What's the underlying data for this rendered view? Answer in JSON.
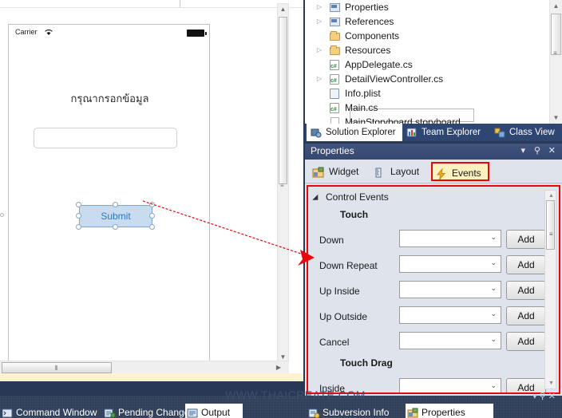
{
  "designer": {
    "device": {
      "status_bar": {
        "carrier": "Carrier",
        "wifi_icon": "wifi-icon",
        "battery_icon": "battery-icon"
      },
      "label_text": "กรุณากรอกข้อมูล",
      "text_field_value": "",
      "submit_button_label": "Submit"
    },
    "h_scroll_grip": "⦀",
    "h_scroll_right_arrow": "▶",
    "v_scroll_up_arrow": "▲",
    "v_scroll_down_arrow": "▼",
    "v_scroll_grip": "≡"
  },
  "solution_explorer": {
    "tree": [
      {
        "label": "Properties",
        "icon": "properties-icon",
        "expander": "▷",
        "indent": 30
      },
      {
        "label": "References",
        "icon": "references-icon",
        "expander": "▷",
        "indent": 30
      },
      {
        "label": "Components",
        "icon": "folder-icon",
        "expander": "",
        "indent": 30
      },
      {
        "label": "Resources",
        "icon": "folder-icon",
        "expander": "▷",
        "indent": 30
      },
      {
        "label": "AppDelegate.cs",
        "icon": "csharp-file-icon",
        "expander": "",
        "indent": 30
      },
      {
        "label": "DetailViewController.cs",
        "icon": "csharp-file-icon",
        "expander": "▷",
        "indent": 30
      },
      {
        "label": "Info.plist",
        "icon": "plist-file-icon",
        "expander": "",
        "indent": 30
      },
      {
        "label": "Main.cs",
        "icon": "csharp-file-icon",
        "expander": "",
        "indent": 30
      },
      {
        "label": "MainStoryboard.storyboard",
        "icon": "storyboard-icon",
        "expander": "",
        "indent": 30
      }
    ],
    "scroll_up_arrow": "▲",
    "scroll_down_arrow": "▼",
    "scroll_grip": "≡"
  },
  "dock_tabs_top": [
    {
      "label": "Solution Explorer",
      "icon": "solution-explorer-icon",
      "active": true
    },
    {
      "label": "Team Explorer",
      "icon": "team-explorer-icon",
      "active": false
    },
    {
      "label": "Class View",
      "icon": "class-view-icon",
      "active": false
    }
  ],
  "properties_panel": {
    "title": "Properties",
    "title_controls": {
      "dropdown_icon": "▾",
      "pin_icon": "⚲",
      "close_icon": "✕"
    },
    "tabs": [
      {
        "label": "Widget",
        "icon": "widget-icon",
        "active": false
      },
      {
        "label": "Layout",
        "icon": "layout-icon",
        "active": false
      },
      {
        "label": "Events",
        "icon": "events-lightning-icon",
        "active": true
      }
    ],
    "group_header": "Control Events",
    "group_expander_icon": "collapse-triangle-icon",
    "sections": [
      {
        "title": "Touch",
        "rows": [
          {
            "label": "Down",
            "value": "",
            "button": "Add"
          },
          {
            "label": "Down Repeat",
            "value": "",
            "button": "Add"
          },
          {
            "label": "Up Inside",
            "value": "",
            "button": "Add"
          },
          {
            "label": "Up Outside",
            "value": "",
            "button": "Add"
          },
          {
            "label": "Cancel",
            "value": "",
            "button": "Add"
          }
        ]
      },
      {
        "title": "Touch Drag",
        "rows": [
          {
            "label": "Inside",
            "value": "",
            "button": "Add"
          }
        ]
      }
    ],
    "combo_chevron": "⌄",
    "scroll_up_arrow": "▲",
    "scroll_down_arrow": "▼",
    "scroll_grip": "≡",
    "highlight_color": "#e8060c",
    "active_tab_bg": "#fdf0c0"
  },
  "dock_tabs_bottom": [
    {
      "label": "Command Window",
      "icon": "command-window-icon",
      "active": false
    },
    {
      "label": "Pending Changes",
      "icon": "pending-changes-icon",
      "active": false
    },
    {
      "label": "Output",
      "icon": "output-icon",
      "active": true
    },
    {
      "label": "Subversion Info",
      "icon": "subversion-icon",
      "active": false
    },
    {
      "label": "Properties",
      "icon": "properties-pane-icon",
      "active": true
    }
  ],
  "watermark": "WWW.THAICREATE.COM",
  "dock_controls": {
    "dropdown_icon": "▾",
    "pin_icon": "⚲",
    "close_icon": "✕"
  }
}
